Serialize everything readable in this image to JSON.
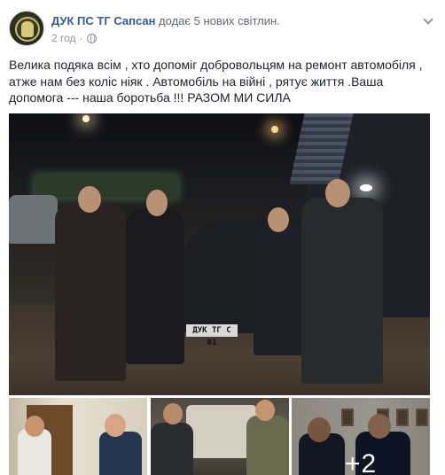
{
  "post": {
    "author": "ДУК ПС ТГ Сапсан",
    "action": "додає 5 нових світлин.",
    "time": "2 год",
    "separator": "·",
    "text": "Велика подяка всім , хто допоміг добровольцям на ремонт автомобіля , атже нам без коліс ніяк . Автомобіль на війні , рятує життя .Ваша допомога --- наша боротьба !!! РАЗОМ МИ СИЛА",
    "main_photo": {
      "plate": "ДУК ТГ С 01"
    },
    "thumbnails": {
      "more_count": "+2"
    }
  },
  "icons": {
    "audience": "globe-icon",
    "options": "chevron-down-icon"
  }
}
